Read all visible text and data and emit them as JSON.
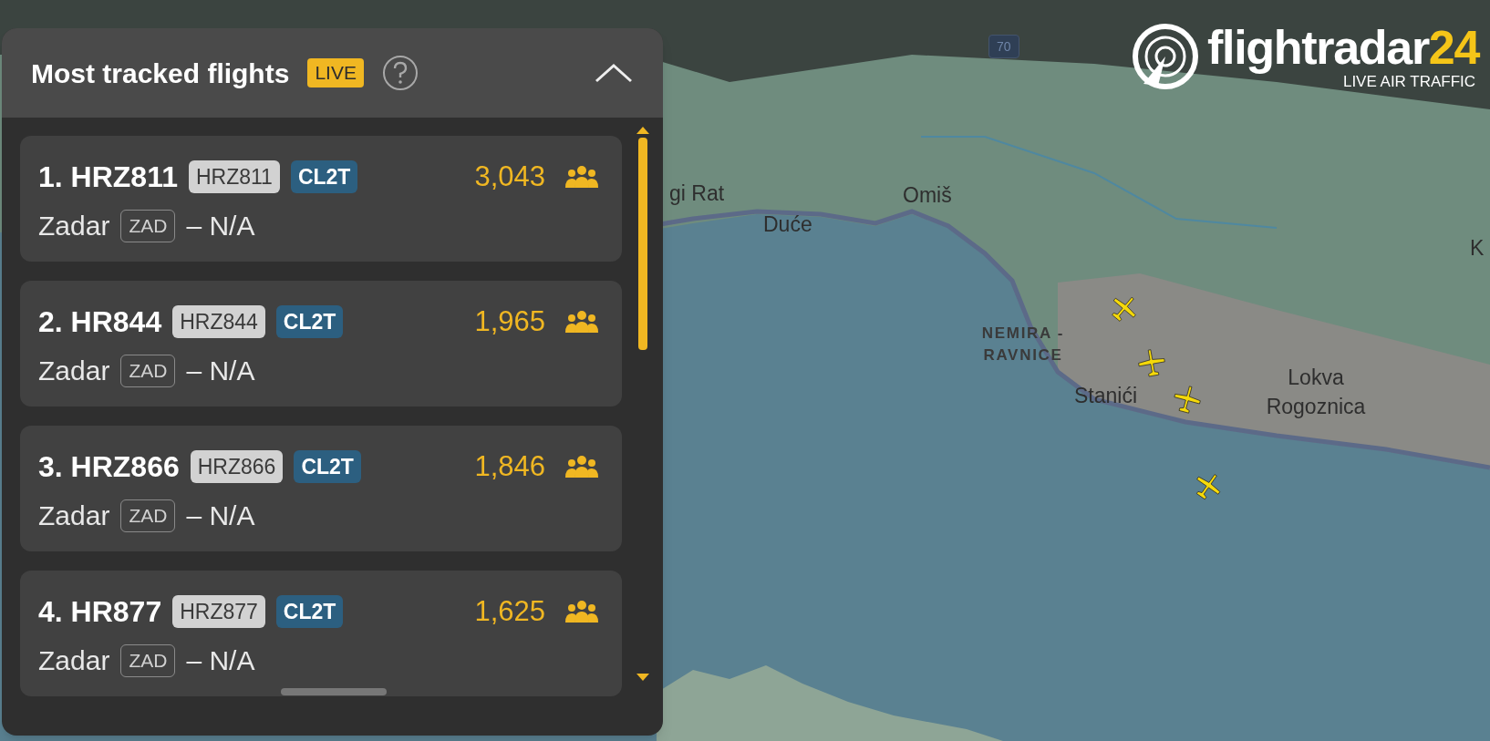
{
  "panel": {
    "title": "Most tracked flights",
    "live_badge": "LIVE",
    "expanded": true
  },
  "flights": [
    {
      "rank_callsign": "1. HRZ811",
      "callsign_tag": "HRZ811",
      "aircraft_type": "CL2T",
      "trackers": "3,043",
      "origin": "Zadar",
      "origin_code": "ZAD",
      "destination": "– N/A"
    },
    {
      "rank_callsign": "2. HR844",
      "callsign_tag": "HRZ844",
      "aircraft_type": "CL2T",
      "trackers": "1,965",
      "origin": "Zadar",
      "origin_code": "ZAD",
      "destination": "– N/A"
    },
    {
      "rank_callsign": "3. HRZ866",
      "callsign_tag": "HRZ866",
      "aircraft_type": "CL2T",
      "trackers": "1,846",
      "origin": "Zadar",
      "origin_code": "ZAD",
      "destination": "– N/A"
    },
    {
      "rank_callsign": "4. HR877",
      "callsign_tag": "HRZ877",
      "aircraft_type": "CL2T",
      "trackers": "1,625",
      "origin": "Zadar",
      "origin_code": "ZAD",
      "destination": "– N/A"
    }
  ],
  "logo": {
    "name_part": "flightradar",
    "number_part": "24",
    "tagline": "LIVE AIR TRAFFIC"
  },
  "map": {
    "road_shield": "70",
    "labels": [
      {
        "text": "gi Rat",
        "kind": "place"
      },
      {
        "text": "Omiš",
        "kind": "place"
      },
      {
        "text": "Duće",
        "kind": "place"
      },
      {
        "text": "NEMIRA - RAVNICE",
        "kind": "area"
      },
      {
        "text": "Stanići",
        "kind": "place"
      },
      {
        "text": "Lokva Rogoznica",
        "kind": "place"
      },
      {
        "text": "K",
        "kind": "place"
      }
    ]
  }
}
